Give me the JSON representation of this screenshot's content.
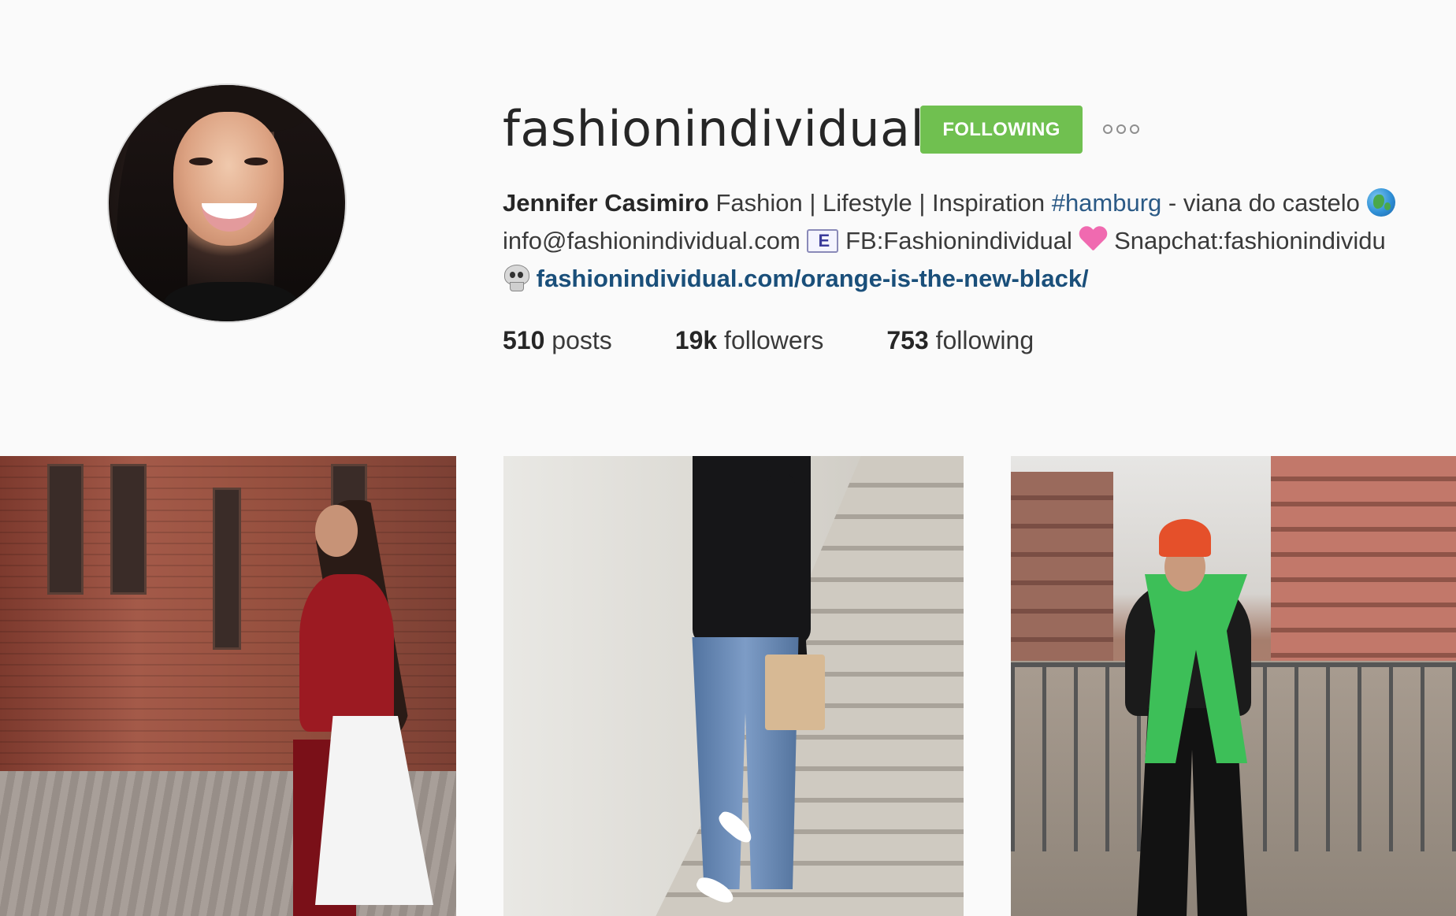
{
  "profile": {
    "username": "fashionindividual",
    "follow_button": "FOLLOWING",
    "bio": {
      "line1": {
        "name": "Jennifer Casimiro",
        "text": " Fashion | Lifestyle | Inspiration ",
        "hashtag": "#hamburg",
        "text2": " - viana do castelo "
      },
      "line2": {
        "email": "info@fashionindividual.com ",
        "fb": " FB:Fashionindividual ",
        "snapchat": " Snapchat:fashionindividu"
      },
      "line3": {
        "link": "fashionindividual.com/orange-is-the-new-black/"
      },
      "icons": [
        "globe-emoji",
        "envelope-emoji",
        "heart-emoji",
        "skull-emoji"
      ]
    },
    "stats": {
      "posts_num": "510",
      "posts_label": " posts",
      "followers_num": "19k",
      "followers_label": " followers",
      "following_num": "753",
      "following_label": " following"
    }
  },
  "colors": {
    "follow_button_bg": "#70c050",
    "link": "#1a4f7a",
    "page_bg": "#fafafa"
  },
  "posts": [
    {
      "label": "post-1"
    },
    {
      "label": "post-2"
    },
    {
      "label": "post-3"
    }
  ]
}
